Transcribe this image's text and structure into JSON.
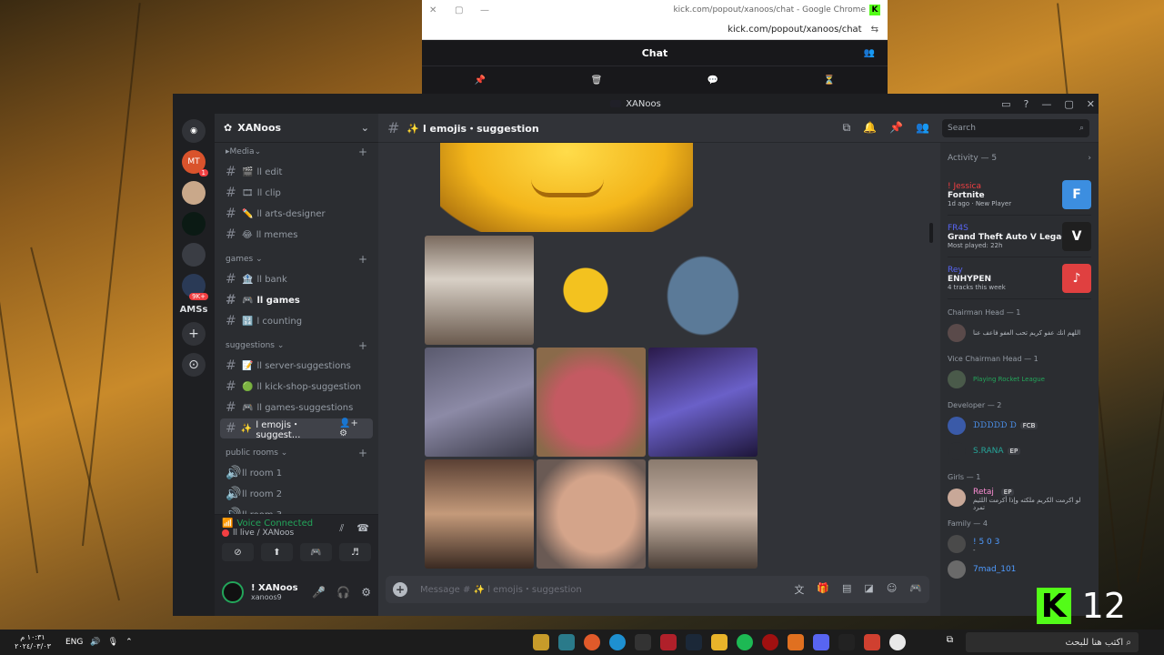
{
  "chrome": {
    "title": "kick.com/popout/xanoos/chat - Google Chrome",
    "url": "kick.com/popout/xanoos/chat",
    "chat_header": "Chat"
  },
  "discord": {
    "window_title": "XANoos",
    "server_name": "XANoos",
    "guild_label": "AMSs",
    "guild_badges": [
      "1",
      "9K+"
    ],
    "categories": [
      {
        "name": "Media",
        "channels": [
          {
            "name": "ll edit",
            "emoji": "🎬"
          },
          {
            "name": "ll clip",
            "emoji": "🎞"
          },
          {
            "name": "ll arts-designer",
            "emoji": "✏️"
          },
          {
            "name": "ll memes",
            "emoji": "😂"
          }
        ]
      },
      {
        "name": "games",
        "channels": [
          {
            "name": "ll bank",
            "emoji": "🏦"
          },
          {
            "name": "ll games",
            "emoji": "🎮"
          },
          {
            "name": "l counting",
            "emoji": "🔢"
          }
        ]
      },
      {
        "name": "suggestions",
        "channels": [
          {
            "name": "ll server-suggestions",
            "emoji": "📝"
          },
          {
            "name": "ll kick-shop-suggestion",
            "emoji": "🟢"
          },
          {
            "name": "ll games-suggestions",
            "emoji": "🎮"
          },
          {
            "name": "l emojis・suggest...",
            "emoji": "✨"
          }
        ]
      },
      {
        "name": "public rooms",
        "channels": [
          {
            "name": "ll room 1"
          },
          {
            "name": "ll room 2"
          },
          {
            "name": "ll room 3"
          }
        ]
      }
    ],
    "voice": {
      "status": "Voice Connected",
      "channel": "ll live / XANoos"
    },
    "user": {
      "name": "! XANoos",
      "tag": "xanoos9"
    },
    "channel_title": "l emojis・suggestion",
    "search_placeholder": "Search",
    "composer_placeholder": "Message # ✨ l emojis・suggestion",
    "activity": {
      "header": "Activity — 5",
      "items": [
        {
          "user": "! Jessica",
          "game": "Fortnite",
          "meta": "1d ago · New Player",
          "thumb": "F",
          "color": "#3c8ee0"
        },
        {
          "user": "FR4S",
          "game": "Grand Theft Auto V Legacy",
          "meta": "Most played: 22h",
          "thumb": "V",
          "color": "#1f1f1f"
        },
        {
          "user": "Rey",
          "game": "ENHYPEN",
          "meta": "4 tracks this week",
          "thumb": "♪",
          "color": "#e04040"
        }
      ]
    },
    "member_groups": [
      {
        "name": "Chairman Head — 1",
        "members": [
          {
            "name": "",
            "status": "اللهم انك عفو كريم تحب العفو فاعف عنا"
          }
        ]
      },
      {
        "name": "Vice Chairman Head — 1",
        "members": [
          {
            "name": "",
            "status": "Playing Rocket League"
          }
        ]
      },
      {
        "name": "Developer — 2",
        "members": [
          {
            "name": "ᗪᗪᗪᗪᗪ ᗪ",
            "tag": "FCB"
          },
          {
            "name": "S.RANA",
            "tag": "EP"
          }
        ]
      },
      {
        "name": "Girls — 1",
        "members": [
          {
            "name": "Retaj",
            "tag": "EP",
            "status": "لو اكرمت الكريم ملكته وإذا أكرمت اللئيم تمرد"
          }
        ]
      },
      {
        "name": "Family — 4",
        "members": [
          {
            "name": "! 5 0 3",
            "status": "-"
          },
          {
            "name": "7mad_101",
            "status": ""
          }
        ]
      }
    ]
  },
  "watermark": {
    "number": "12"
  },
  "taskbar": {
    "time": "١٠:٣١ م",
    "date": "٢٠٢٤/٠٣/٠٣",
    "lang": "ENG",
    "search": "اكتب هنا للبحث"
  }
}
